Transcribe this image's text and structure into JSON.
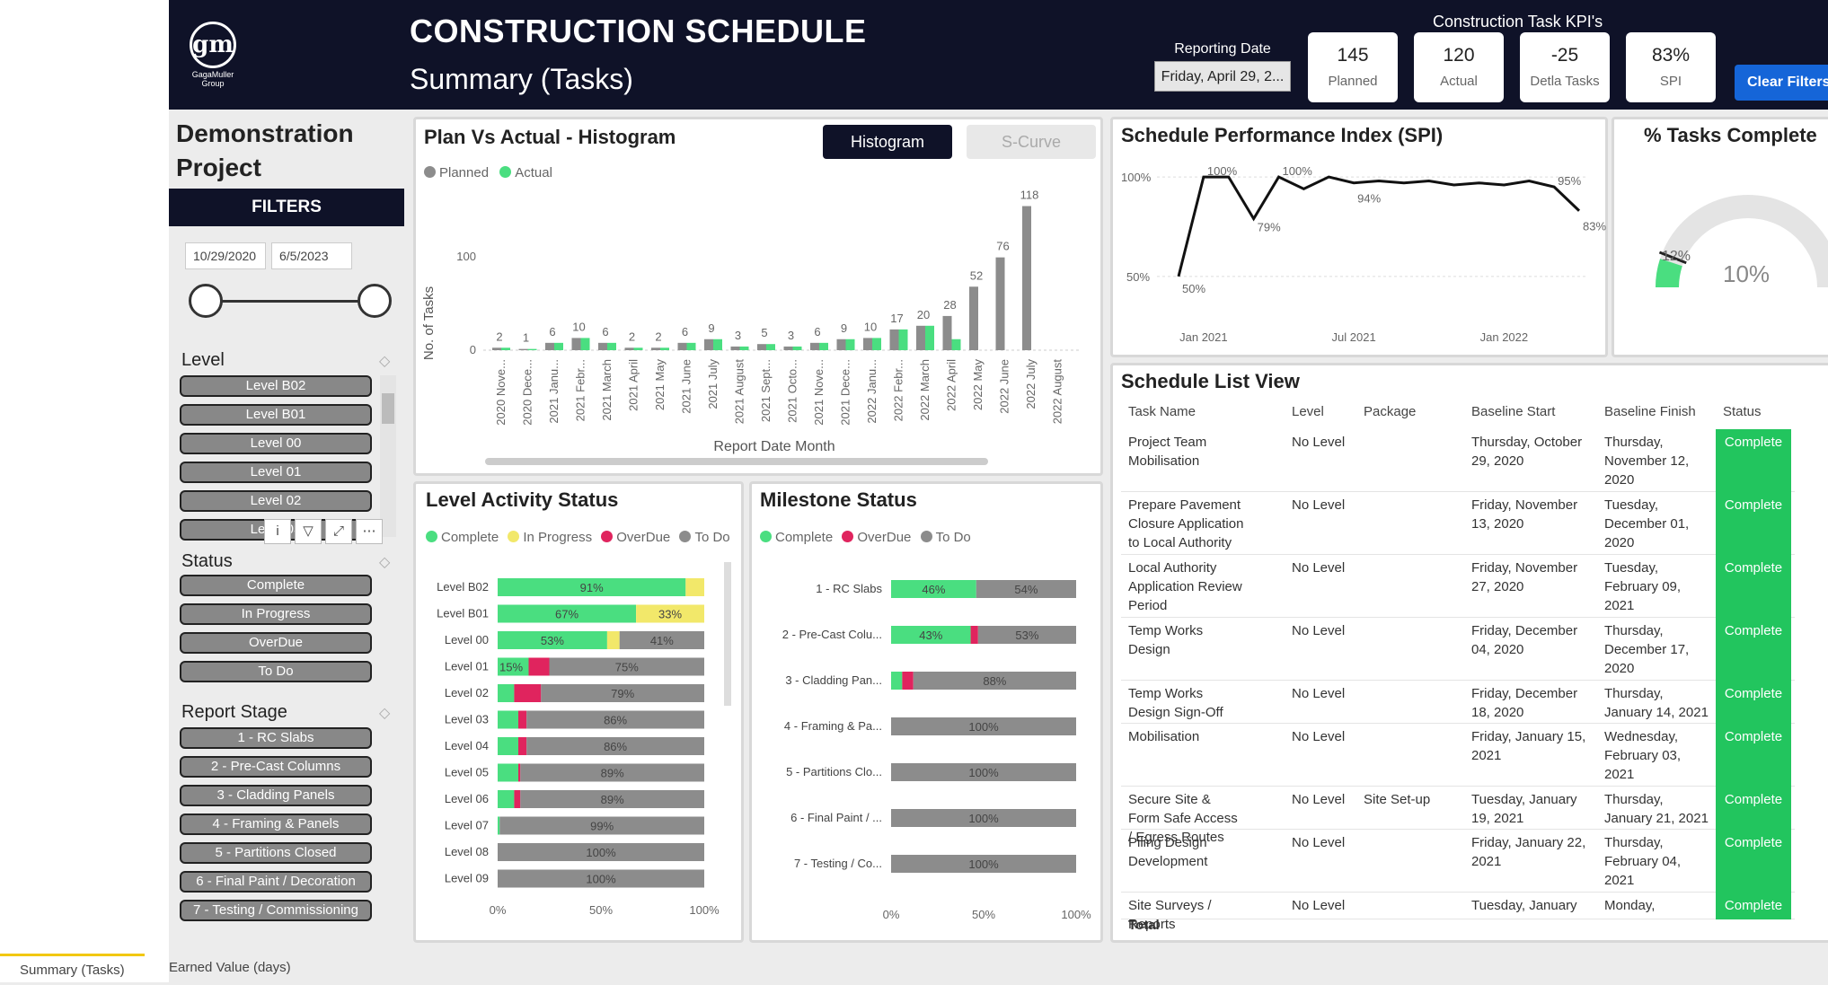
{
  "header": {
    "logo_text": "gm",
    "logo_sub": "GagaMuller Group",
    "title": "CONSTRUCTION SCHEDULE",
    "subtitle": "Summary (Tasks)",
    "kpi_title": "Construction Task KPI's",
    "reporting_date_label": "Reporting Date",
    "reporting_date_value": "Friday, April 29, 2...",
    "clear_filters": "Clear Filters",
    "kpis": [
      {
        "value": "145",
        "label": "Planned"
      },
      {
        "value": "120",
        "label": "Actual"
      },
      {
        "value": "-25",
        "label": "Detla Tasks"
      },
      {
        "value": "83%",
        "label": "SPI"
      }
    ]
  },
  "sidebar": {
    "project": "Demonstration Project",
    "filters": "FILTERS",
    "date_from": "10/29/2020",
    "date_to": "6/5/2023",
    "level_title": "Level",
    "levels": [
      "Level B02",
      "Level B01",
      "Level 00",
      "Level 01",
      "Level 02",
      "Level 03"
    ],
    "status_title": "Status",
    "statuses": [
      "Complete",
      "In Progress",
      "OverDue",
      "To Do"
    ],
    "stage_title": "Report Stage",
    "stages": [
      "1 - RC Slabs",
      "2 - Pre-Cast Columns",
      "3 - Cladding Panels",
      "4 - Framing & Panels",
      "5 - Partitions Closed",
      "6 - Final Paint / Decoration",
      "7 - Testing / Commissioning"
    ]
  },
  "histogram": {
    "title": "Plan Vs Actual - Histogram",
    "btn_histogram": "Histogram",
    "btn_scurve": "S-Curve",
    "legend": [
      "Planned",
      "Actual"
    ],
    "ylabel": "No. of Tasks",
    "xlabel": "Report Date Month",
    "y_ticks": [
      "0",
      "100"
    ]
  },
  "spi_panel": {
    "title": "Schedule Performance Index (SPI)",
    "y_ticks": [
      "100%",
      "50%"
    ],
    "x_ticks": [
      "Jan 2021",
      "Jul 2021",
      "Jan 2022"
    ],
    "point_labels": [
      "50%",
      "100%",
      "79%",
      "100%",
      "94%",
      "95%",
      "83%"
    ]
  },
  "pct_panel": {
    "title": "% Tasks Complete",
    "value": "10%",
    "target": "12%"
  },
  "level_status": {
    "title": "Level Activity Status",
    "legend": [
      "Complete",
      "In Progress",
      "OverDue",
      "To Do"
    ],
    "x_ticks": [
      "0%",
      "50%",
      "100%"
    ]
  },
  "milestone": {
    "title": "Milestone Status",
    "legend": [
      "Complete",
      "OverDue",
      "To Do"
    ],
    "x_ticks": [
      "0%",
      "50%",
      "100%"
    ]
  },
  "schedule": {
    "title": "Schedule List View",
    "columns": [
      "Task Name",
      "Level",
      "Package",
      "Baseline Start",
      "Baseline Finish",
      "Status"
    ],
    "total": "Total",
    "rows": [
      {
        "task": "Project Team Mobilisation",
        "level": "No Level",
        "package": "",
        "start": "Thursday, October 29, 2020",
        "finish": "Thursday, November 12, 2020",
        "status": "Complete"
      },
      {
        "task": "Prepare Pavement Closure Application to Local Authority",
        "level": "No Level",
        "package": "",
        "start": "Friday, November 13, 2020",
        "finish": "Tuesday, December 01, 2020",
        "status": "Complete"
      },
      {
        "task": "Local Authority Application Review Period",
        "level": "No Level",
        "package": "",
        "start": "Friday, November 27, 2020",
        "finish": "Tuesday, February 09, 2021",
        "status": "Complete"
      },
      {
        "task": "Temp Works Design",
        "level": "No Level",
        "package": "",
        "start": "Friday, December 04, 2020",
        "finish": "Thursday, December 17, 2020",
        "status": "Complete"
      },
      {
        "task": "Temp Works Design Sign-Off",
        "level": "No Level",
        "package": "",
        "start": "Friday, December 18, 2020",
        "finish": "Thursday, January 14, 2021",
        "status": "Complete"
      },
      {
        "task": "Mobilisation",
        "level": "No Level",
        "package": "",
        "start": "Friday, January 15, 2021",
        "finish": "Wednesday, February 03, 2021",
        "status": "Complete"
      },
      {
        "task": "Secure Site & Form Safe Access / Egress Routes",
        "level": "No Level",
        "package": "Site Set-up",
        "start": "Tuesday, January 19, 2021",
        "finish": "Thursday, January 21, 2021",
        "status": "Complete"
      },
      {
        "task": "Piling Design Development",
        "level": "No Level",
        "package": "",
        "start": "Friday, January 22, 2021",
        "finish": "Thursday, February 04, 2021",
        "status": "Complete"
      },
      {
        "task": "Site Surveys / Reports",
        "level": "No Level",
        "package": "",
        "start": "Tuesday, January",
        "finish": "Monday,",
        "status": "Complete"
      }
    ]
  },
  "tabs": [
    "Summary (Tasks)",
    "Earned Value (days)"
  ],
  "colors": {
    "complete": "#4ade80",
    "inprogress": "#f2e86a",
    "overdue": "#e0245e",
    "todo": "#8c8c8c",
    "planned": "#8c8c8c"
  },
  "chart_data": [
    {
      "type": "bar",
      "title": "Plan Vs Actual - Histogram",
      "xlabel": "Report Date Month",
      "ylabel": "No. of Tasks",
      "categories": [
        "2020 Nove...",
        "2020 Dece...",
        "2021 Janu...",
        "2021 Febr...",
        "2021 March",
        "2021 April",
        "2021 May",
        "2021 June",
        "2021 July",
        "2021 August",
        "2021 Sept...",
        "2021 Octo...",
        "2021 Nove...",
        "2021 Dece...",
        "2022 Janu...",
        "2022 Febr...",
        "2022 March",
        "2022 April",
        "2022 May",
        "2022 June",
        "2022 July",
        "2022 August"
      ],
      "series": [
        {
          "name": "Planned",
          "values": [
            2,
            1,
            6,
            10,
            6,
            2,
            2,
            6,
            9,
            3,
            5,
            3,
            6,
            9,
            10,
            17,
            20,
            28,
            52,
            76,
            118,
            null
          ]
        },
        {
          "name": "Actual",
          "values": [
            2,
            1,
            6,
            10,
            6,
            2,
            2,
            6,
            9,
            3,
            5,
            3,
            6,
            9,
            10,
            17,
            20,
            9,
            null,
            null,
            null,
            null
          ]
        }
      ],
      "ylim": [
        0,
        125
      ]
    },
    {
      "type": "line",
      "title": "Schedule Performance Index (SPI)",
      "x": [
        "2020-12",
        "2021-01",
        "2021-02",
        "2021-03",
        "2021-04",
        "2021-05",
        "2021-06",
        "2021-07",
        "2021-08",
        "2021-09",
        "2021-10",
        "2021-11",
        "2021-12",
        "2022-01",
        "2022-02",
        "2022-03",
        "2022-04"
      ],
      "series": [
        {
          "values": [
            50,
            100,
            100,
            79,
            100,
            94,
            100,
            97,
            98,
            97,
            98,
            96,
            97,
            96,
            98,
            95,
            83
          ]
        }
      ],
      "ylim": [
        40,
        105
      ]
    },
    {
      "type": "bar",
      "title": "Level Activity Status",
      "categories": [
        "Level B02",
        "Level B01",
        "Level 00",
        "Level 01",
        "Level 02",
        "Level 03",
        "Level 04",
        "Level 05",
        "Level 06",
        "Level 07",
        "Level 08",
        "Level 09"
      ],
      "series": [
        {
          "name": "Complete",
          "values": [
            91,
            67,
            53,
            15,
            8,
            10,
            10,
            10,
            8,
            1,
            0,
            0
          ]
        },
        {
          "name": "In Progress",
          "values": [
            9,
            33,
            6,
            0,
            0,
            0,
            0,
            0,
            0,
            0,
            0,
            0
          ]
        },
        {
          "name": "OverDue",
          "values": [
            0,
            0,
            0,
            10,
            13,
            4,
            4,
            1,
            3,
            0,
            0,
            0
          ]
        },
        {
          "name": "To Do",
          "values": [
            0,
            0,
            41,
            75,
            79,
            86,
            86,
            89,
            89,
            99,
            100,
            100
          ]
        }
      ],
      "ylim": [
        0,
        100
      ]
    },
    {
      "type": "bar",
      "title": "Milestone Status",
      "categories": [
        "1 - RC Slabs",
        "2 - Pre-Cast Colu...",
        "3 - Cladding Pan...",
        "4 - Framing & Pa...",
        "5 - Partitions Clo...",
        "6 - Final Paint / ...",
        "7 - Testing / Co..."
      ],
      "series": [
        {
          "name": "Complete",
          "values": [
            46,
            43,
            6,
            0,
            0,
            0,
            0
          ]
        },
        {
          "name": "OverDue",
          "values": [
            0,
            4,
            6,
            0,
            0,
            0,
            0
          ]
        },
        {
          "name": "To Do",
          "values": [
            54,
            53,
            88,
            100,
            100,
            100,
            100
          ]
        }
      ],
      "ylim": [
        0,
        100
      ]
    },
    {
      "type": "pie",
      "title": "% Tasks Complete",
      "values": [
        10,
        90
      ],
      "target": 12
    }
  ]
}
